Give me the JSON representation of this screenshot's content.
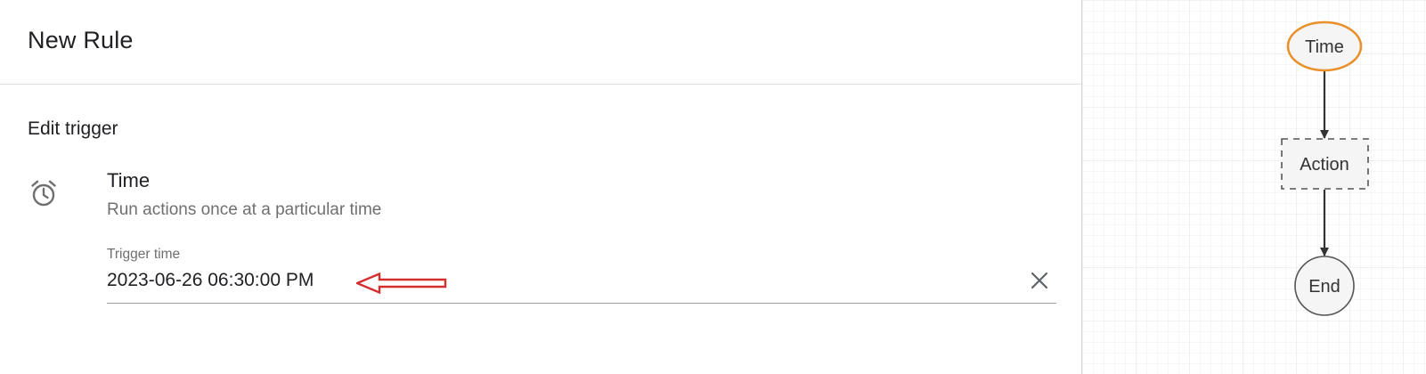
{
  "header": {
    "title": "New Rule"
  },
  "editor": {
    "section_title": "Edit trigger",
    "trigger": {
      "icon": "alarm-clock-icon",
      "name": "Time",
      "description": "Run actions once at a particular time"
    },
    "trigger_time_field": {
      "label": "Trigger time",
      "value": "2023-06-26 06:30:00 PM",
      "clear_icon": "close-icon"
    },
    "annotation": {
      "icon": "left-arrow-icon",
      "color": "#d32f2f"
    }
  },
  "flow": {
    "nodes": [
      {
        "label": "Time",
        "shape": "ellipse",
        "border_color": "#e8912c"
      },
      {
        "label": "Action",
        "shape": "dashed-rectangle",
        "border_color": "#555555"
      },
      {
        "label": "End",
        "shape": "circle",
        "border_color": "#555555"
      }
    ],
    "grid": true
  },
  "colors": {
    "accent_orange": "#e8912c",
    "arrow_red": "#d32f2f",
    "text_primary": "#202124",
    "text_secondary": "#6f6f6f"
  }
}
